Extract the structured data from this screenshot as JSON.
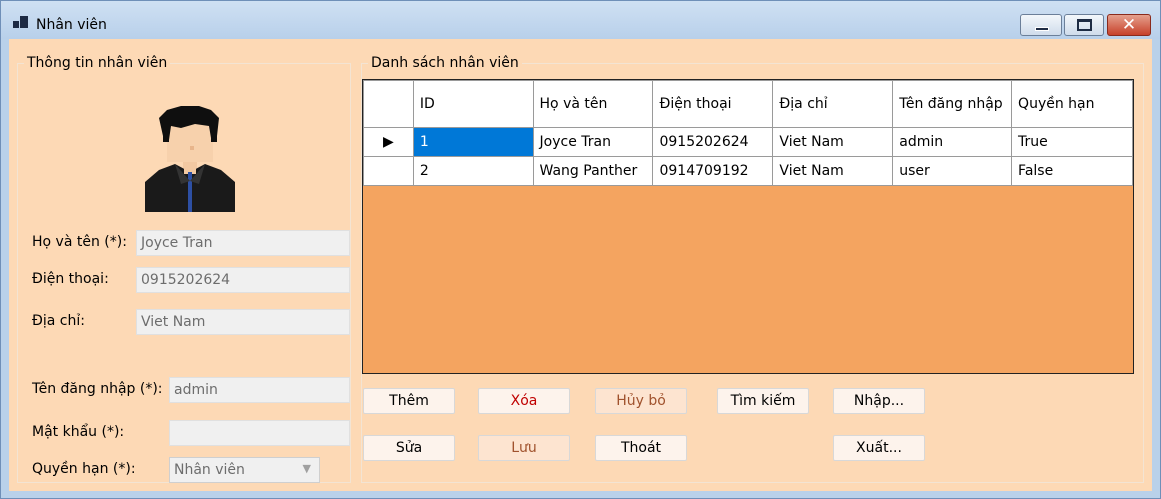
{
  "window": {
    "title": "Nhân viên"
  },
  "info_group": {
    "title": "Thông tin nhân viên",
    "fields": [
      {
        "label": "Họ và tên (*):",
        "value": "Joyce Tran"
      },
      {
        "label": "Điện thoại:",
        "value": "0915202624"
      },
      {
        "label": "Địa chỉ:",
        "value": "Viet Nam"
      },
      {
        "label": "Tên đăng nhập (*):",
        "value": "admin"
      },
      {
        "label": "Mật khẩu (*):",
        "value": ""
      },
      {
        "label": "Quyền hạn (*):",
        "value": "Nhân viên"
      }
    ]
  },
  "list_group": {
    "title": "Danh sách nhân viên"
  },
  "grid": {
    "columns": [
      "ID",
      "Họ và tên",
      "Điện thoại",
      "Địa chỉ",
      "Tên đăng nhập",
      "Quyền hạn"
    ],
    "rows": [
      [
        "1",
        "Joyce Tran",
        "0915202624",
        "Viet Nam",
        "admin",
        "True"
      ],
      [
        "2",
        "Wang Panther",
        "0914709192",
        "Viet Nam",
        "user",
        "False"
      ]
    ],
    "current_row_marker": "▶"
  },
  "buttons": {
    "add": "Thêm",
    "delete": "Xóa",
    "cancel": "Hủy bỏ",
    "search": "Tìm kiếm",
    "import": "Nhập...",
    "edit": "Sửa",
    "save": "Lưu",
    "exit": "Thoát",
    "export": "Xuất..."
  },
  "colors": {
    "form_background": "#fdd9b5",
    "grid_background": "#f4a460",
    "selection": "#0078d7",
    "delete_text": "#c00000"
  }
}
